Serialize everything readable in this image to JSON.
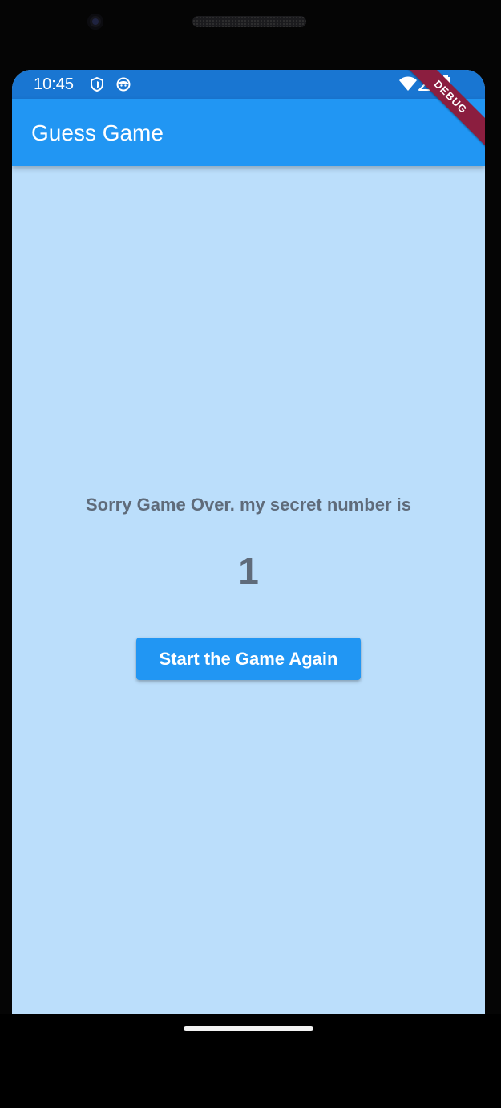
{
  "status_bar": {
    "time": "10:45",
    "icons_left": [
      "shield-icon",
      "face-icon"
    ],
    "icons_right": [
      "wifi-icon",
      "cell-signal-icon",
      "battery-icon"
    ],
    "color": "#1976d2"
  },
  "app_bar": {
    "title": "Guess Game",
    "color": "#2196f3"
  },
  "debug_banner": {
    "label": "DEBUG",
    "color": "#8b1e3f"
  },
  "main": {
    "message": "Sorry Game Over. my secret number is",
    "secret_number": "1",
    "restart_button_label": "Start the Game Again",
    "background": "#bbdefb",
    "text_color": "#5f6b7a"
  },
  "navigation": {
    "home_indicator": "home-indicator"
  }
}
